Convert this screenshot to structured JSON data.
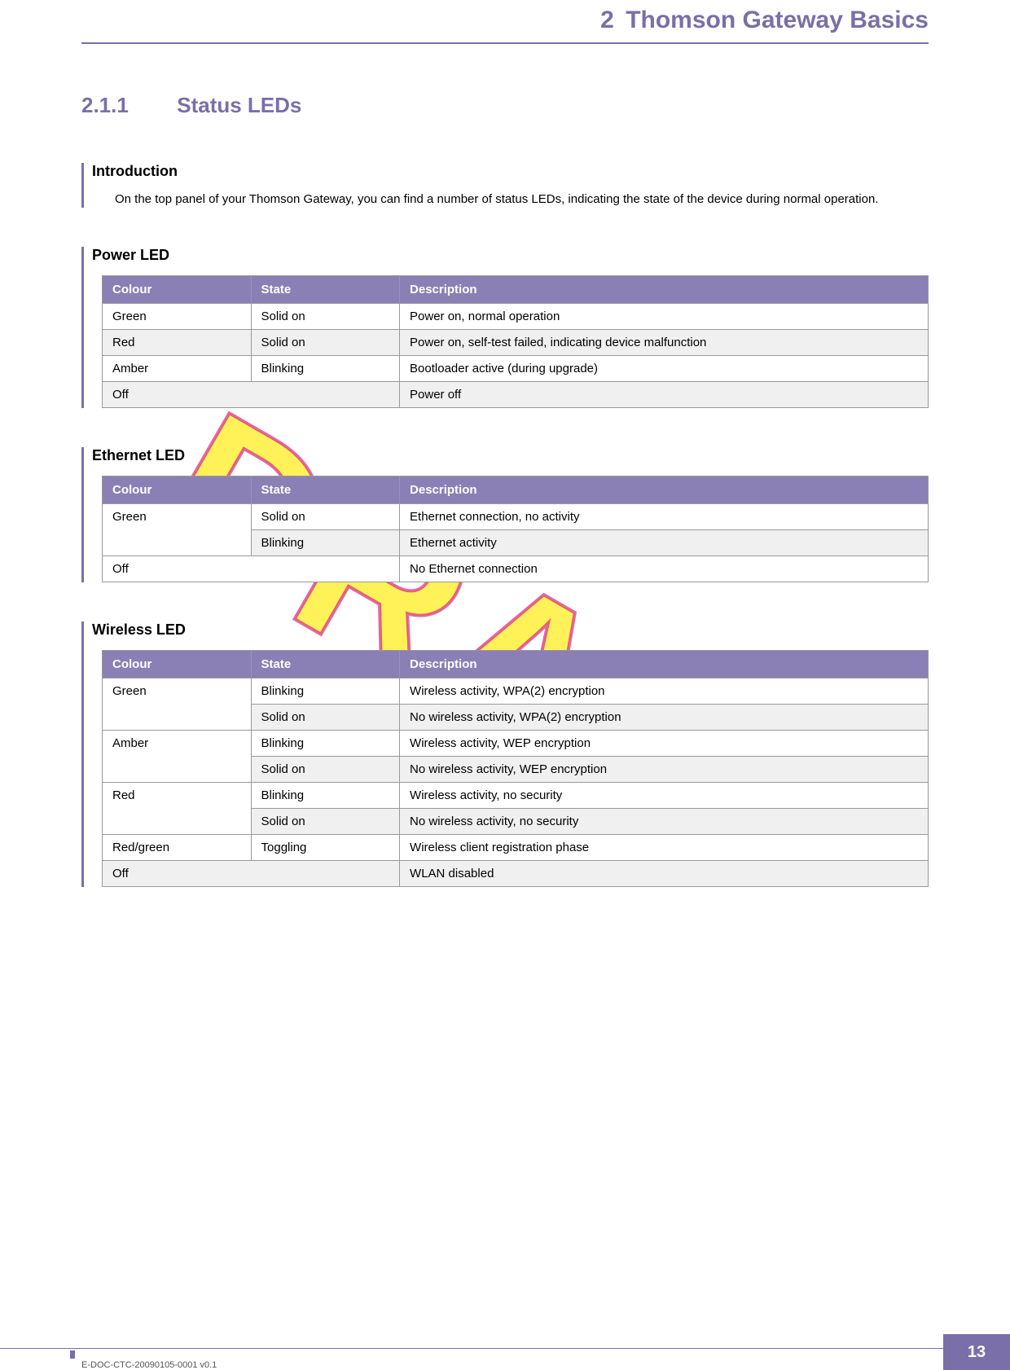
{
  "chapter": {
    "number": "2",
    "title": "Thomson Gateway Basics"
  },
  "section": {
    "number": "2.1.1",
    "title": "Status LEDs"
  },
  "watermark": "DRAFT",
  "intro": {
    "heading": "Introduction",
    "text": "On the top panel of your Thomson Gateway, you can find a number of status LEDs, indicating the state of the device during normal operation."
  },
  "columns": {
    "colour": "Colour",
    "state": "State",
    "description": "Description"
  },
  "tables": [
    {
      "heading": "Power LED",
      "rows": [
        {
          "colour": "Green",
          "state": "Solid on",
          "description": "Power on, normal operation",
          "alt": false,
          "colspanColour": 1
        },
        {
          "colour": "Red",
          "state": "Solid on",
          "description": "Power on, self-test failed, indicating device malfunction",
          "alt": true,
          "colspanColour": 1
        },
        {
          "colour": "Amber",
          "state": "Blinking",
          "description": "Bootloader active (during upgrade)",
          "alt": false,
          "colspanColour": 1
        },
        {
          "colour": "Off",
          "state": "",
          "description": "Power off",
          "alt": true,
          "colspanColour": 2
        }
      ]
    },
    {
      "heading": "Ethernet LED",
      "rows": [
        {
          "colour": "Green",
          "state": "Solid on",
          "description": "Ethernet connection, no activity",
          "alt": false,
          "rowspanColour": 2
        },
        {
          "colour": null,
          "state": "Blinking",
          "description": "Ethernet activity",
          "alt": true
        },
        {
          "colour": "Off",
          "state": "",
          "description": "No Ethernet connection",
          "alt": false,
          "colspanColour": 2
        }
      ]
    },
    {
      "heading": "Wireless LED",
      "rows": [
        {
          "colour": "Green",
          "state": "Blinking",
          "description": "Wireless activity, WPA(2) encryption",
          "alt": false,
          "rowspanColour": 2
        },
        {
          "colour": null,
          "state": "Solid on",
          "description": "No wireless activity, WPA(2) encryption",
          "alt": true
        },
        {
          "colour": "Amber",
          "state": "Blinking",
          "description": "Wireless activity, WEP encryption",
          "alt": false,
          "rowspanColour": 2
        },
        {
          "colour": null,
          "state": "Solid on",
          "description": "No wireless activity, WEP encryption",
          "alt": true
        },
        {
          "colour": "Red",
          "state": "Blinking",
          "description": "Wireless activity, no security",
          "alt": false,
          "rowspanColour": 2
        },
        {
          "colour": null,
          "state": "Solid on",
          "description": "No wireless activity, no security",
          "alt": true
        },
        {
          "colour": "Red/green",
          "state": "Toggling",
          "description": "Wireless client registration phase",
          "alt": false
        },
        {
          "colour": "Off",
          "state": "",
          "description": "WLAN disabled",
          "alt": true,
          "colspanColour": 2
        }
      ]
    }
  ],
  "footer": {
    "doc_id": "E-DOC-CTC-20090105-0001 v0.1",
    "page_number": "13"
  }
}
